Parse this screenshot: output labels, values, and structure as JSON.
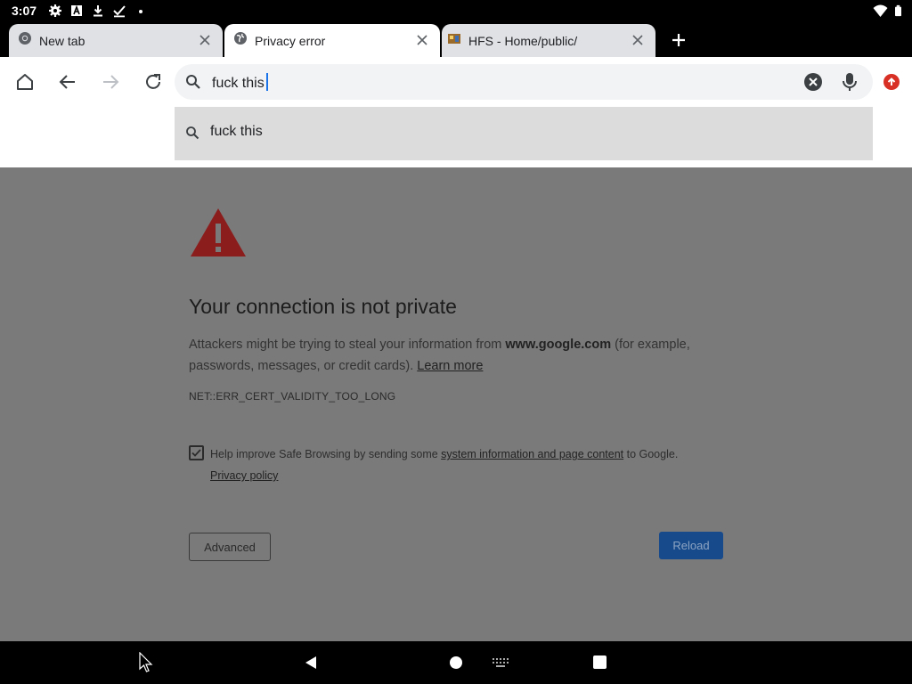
{
  "status_bar": {
    "time": "3:07"
  },
  "tabs": [
    {
      "title": "New tab"
    },
    {
      "title": "Privacy error"
    },
    {
      "title": "HFS - Home/public/"
    }
  ],
  "omnibox": {
    "value": "fuck this"
  },
  "suggestions": [
    {
      "text": "fuck this"
    }
  ],
  "page": {
    "title": "Your connection is not private",
    "body_part1": "Attackers might be trying to steal your information from ",
    "domain": "www.google.com",
    "body_part2": " (for example, passwords, messages, or credit cards). ",
    "learn_more": "Learn more",
    "error_code": "NET::ERR_CERT_VALIDITY_TOO_LONG",
    "safe_browsing_part1": "Help improve Safe Browsing by sending some ",
    "safe_browsing_link": "system information and page content",
    "safe_browsing_part2": " to Google. ",
    "privacy_policy": "Privacy policy",
    "advanced_button": "Advanced",
    "reload_button": "Reload"
  },
  "colors": {
    "warning_red": "#8b1d1d",
    "reload_blue": "#164a8a",
    "caret_blue": "#1a73e8",
    "update_red": "#d93025"
  }
}
